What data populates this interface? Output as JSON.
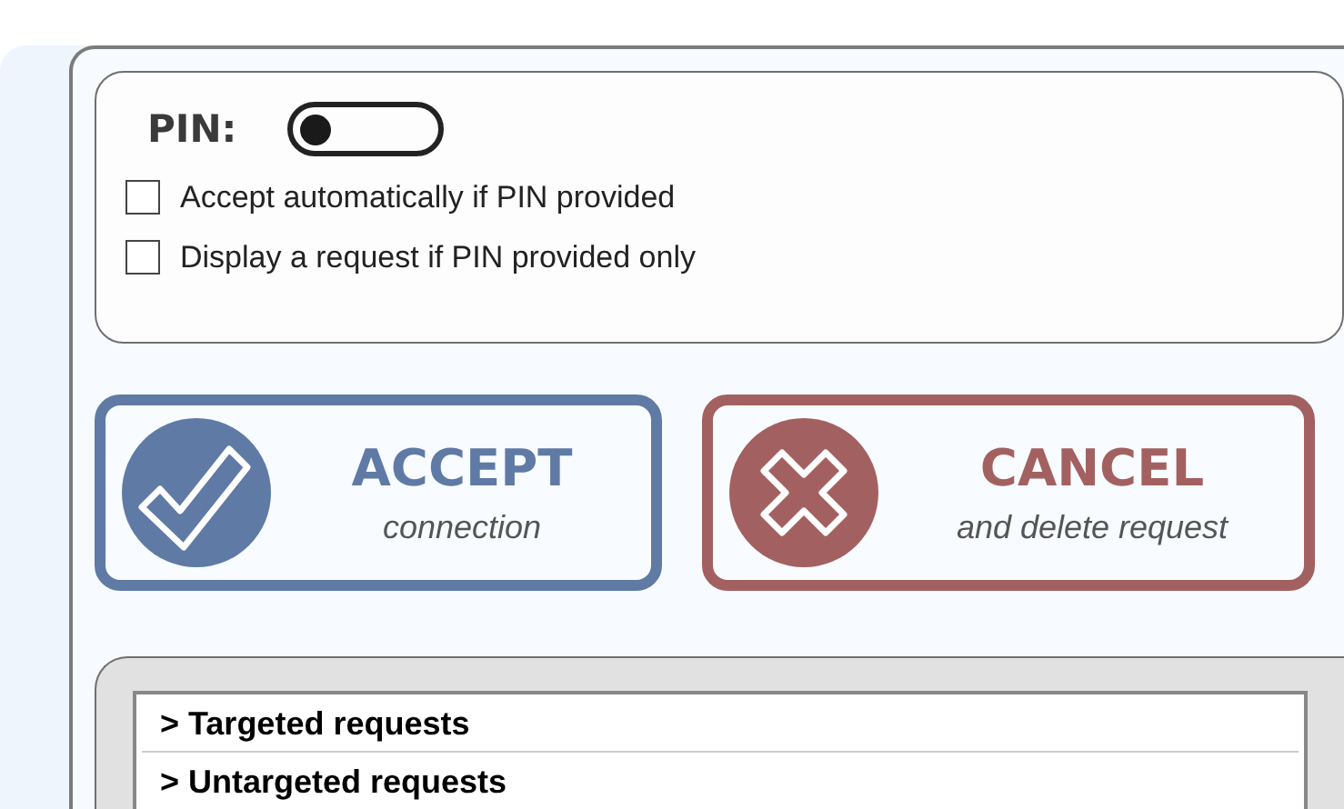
{
  "pin": {
    "label": "PIN:",
    "toggle_on": false,
    "options": [
      {
        "label": "Accept automatically if PIN provided",
        "checked": false
      },
      {
        "label": "Display a request if PIN provided only",
        "checked": false
      }
    ]
  },
  "actions": [
    {
      "kind": "accept",
      "title": "ACCEPT",
      "subtitle": "connection",
      "color": "#5f7aa4"
    },
    {
      "kind": "cancel",
      "title": "CANCEL",
      "subtitle": "and delete request",
      "color": "#a26160"
    }
  ],
  "requests": [
    {
      "label": "> Targeted requests"
    },
    {
      "label": "> Untargeted requests"
    }
  ]
}
